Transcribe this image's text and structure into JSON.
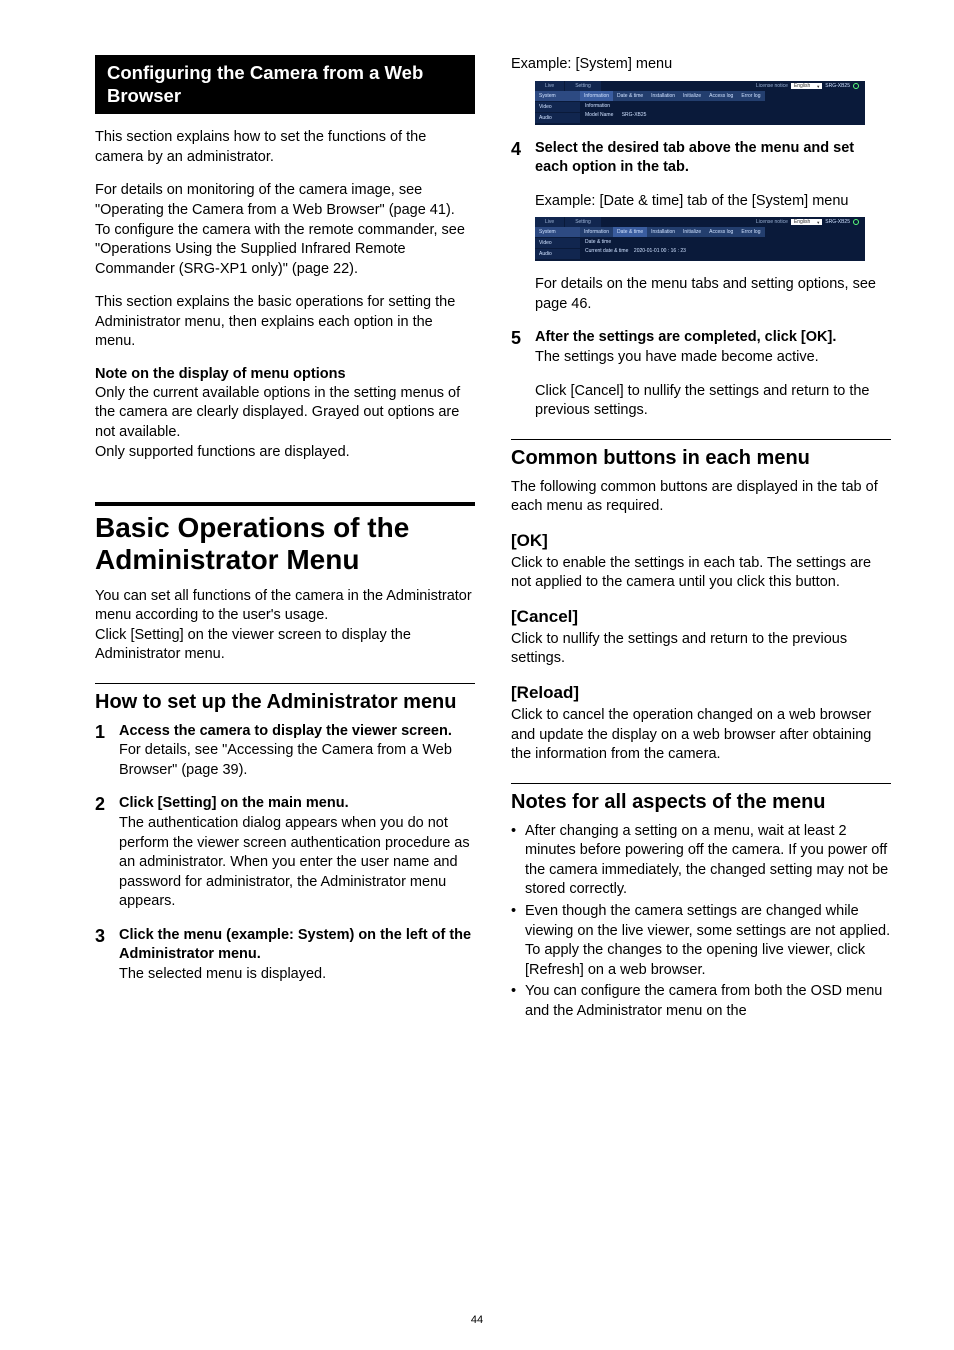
{
  "page_number": "44",
  "left": {
    "sectionbar": "Configuring the Camera from a Web Browser",
    "p1": "This section explains how to set the functions of the camera by an administrator.",
    "p2a": "For details on monitoring of the camera image, see \"Operating the Camera from a Web Browser\" (page 41).",
    "p2b": "To configure the camera with the remote commander, see \"Operations Using the Supplied Infrared Remote Commander (SRG-XP1 only)\" (page 22).",
    "p3": "This section explains the basic operations for setting the Administrator menu, then explains each option in the menu.",
    "note_h": "Note on the display of menu options",
    "note_b": "Only the current available options in the setting menus of the camera are clearly displayed. Grayed out options are not available.\nOnly supported functions are displayed.",
    "h1": "Basic Operations of the Administrator Menu",
    "h1_p1": "You can set all functions of the camera in the Administrator menu according to the user's usage.",
    "h1_p2": "Click [Setting] on the viewer screen to display the Administrator menu.",
    "h2": "How to set up the Administrator menu",
    "steps": [
      {
        "n": "1",
        "lead": "Access the camera to display the viewer screen.",
        "body": "For details, see \"Accessing the Camera from a Web Browser\" (page 39)."
      },
      {
        "n": "2",
        "lead": "Click [Setting] on the main menu.",
        "body": "The authentication dialog appears when you do not perform the viewer screen authentication procedure as an administrator. When you enter the user name and password for administrator, the Administrator menu appears."
      },
      {
        "n": "3",
        "lead": "Click the menu (example: System) on the left of the Administrator menu.",
        "body": "The selected menu is displayed."
      }
    ]
  },
  "right": {
    "ex1": "Example: [System] menu",
    "shot": {
      "live": "Live",
      "setting": "Setting",
      "tabs": [
        "Information",
        "Date & time",
        "Installation",
        "Initialize",
        "Access log",
        "Error log"
      ],
      "side": [
        "System",
        "Video",
        "Audio"
      ],
      "lab1": "Information",
      "lab2": "Model Name",
      "val2": "SRG-XB25",
      "langlab": "License notice",
      "lang": "English",
      "model": "SRG-XB25",
      "dt_lab": "Date & time",
      "dt_cur": "Current date & time",
      "dt_val": "2020-01-01 00 : 16 : 23"
    },
    "step4": {
      "n": "4",
      "lead": "Select the desired tab above the menu and set each option in the tab."
    },
    "ex2": "Example: [Date & time] tab of the [System] menu",
    "after4": "For details on the menu tabs and setting options, see page 46.",
    "step5": {
      "n": "5",
      "lead": "After the settings are completed, click [OK].",
      "body": "The settings you have made become active."
    },
    "after5": "Click [Cancel] to nullify the settings and return to the previous settings.",
    "h_common": "Common buttons in each menu",
    "common_p": "The following common buttons are displayed in the tab of each menu as required.",
    "ok_h": "[OK]",
    "ok_p": "Click to enable the settings in each tab. The settings are not applied to the camera until you click this button.",
    "cancel_h": "[Cancel]",
    "cancel_p": "Click to nullify the settings and return to the previous settings.",
    "reload_h": "[Reload]",
    "reload_p": "Click to cancel the operation changed on a web browser and update the display on a web browser after obtaining the information from the camera.",
    "notes_h": "Notes for all aspects of the menu",
    "notes": [
      "After changing a setting on a menu, wait at least 2 minutes before powering off the camera. If you power off the camera immediately, the changed setting may not be stored correctly.",
      "Even though the camera settings are changed while viewing on the live viewer, some settings are not applied. To apply the changes to the opening live viewer, click [Refresh] on a web browser.",
      "You can configure the camera from both the OSD menu and the Administrator menu on the"
    ]
  }
}
